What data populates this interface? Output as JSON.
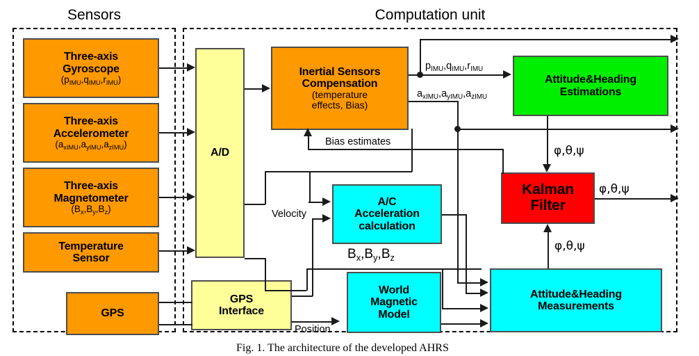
{
  "figure": {
    "caption": "Fig. 1.  The architecture of the developed AHRS"
  },
  "groups": [
    {
      "title": "Sensors"
    },
    {
      "title": "Computation unit"
    }
  ],
  "blocks": {
    "gyroscope": {
      "line1": "Three-axis",
      "line2": "Gyroscope",
      "sub": "(pIMU,qIMU,rIMU)"
    },
    "accelerometer": {
      "line1": "Three-axis",
      "line2": "Accelerometer",
      "sub": "(axIMU,ayIMU,azIMU)"
    },
    "magnetometer": {
      "line1": "Three-axis",
      "line2": "Magnetometer",
      "sub": "(Bx,By,Bz)"
    },
    "temperature": {
      "line1": "Temperature",
      "line2": "Sensor",
      "sub": ""
    },
    "gps": {
      "line1": "GPS",
      "line2": "",
      "sub": ""
    },
    "adc": {
      "line1": "A/D",
      "line2": "",
      "sub": ""
    },
    "gps_interface": {
      "line1": "GPS",
      "line2": "Interface",
      "sub": ""
    },
    "inertial_compensation": {
      "line1": "Inertial Sensors",
      "line2": "Compensation",
      "sub1": "(temperature",
      "sub2": "effects, Bias)"
    },
    "ac_acceleration": {
      "line1": "A/C",
      "line2": "Acceleration",
      "line3": "calculation"
    },
    "world_magnetic": {
      "line1": "World",
      "line2": "Magnetic",
      "line3": "Model"
    },
    "attitude_estimations": {
      "line1": "Attitude&Heading",
      "line2": "Estimations"
    },
    "attitude_measurements": {
      "line1": "Attitude&Heading",
      "line2": "Measurements"
    },
    "kalman": {
      "line1": "Kalman",
      "line2": "Filter"
    }
  },
  "wire_labels": {
    "p_q_r_imu": "pIMU,qIMU,rIMU",
    "a_xyz_imu": "axIMU,ayIMU,azIMU",
    "bias_estimates": "Bias estimates",
    "velocity": "Velocity",
    "position": "Position",
    "b_xyz": "Bx,By,Bz",
    "euler_1": "φ,θ,ψ",
    "euler_2": "φ,θ,ψ",
    "euler_3": "φ,θ,ψ"
  },
  "colors": {
    "sensor_orange": "#ff9900",
    "interface_yellow": "#ffff99",
    "processing_cyan": "#00ffff",
    "estimation_green": "#00ee00",
    "kalman_red": "#ff0000",
    "wire_black": "#1a1a1a"
  }
}
